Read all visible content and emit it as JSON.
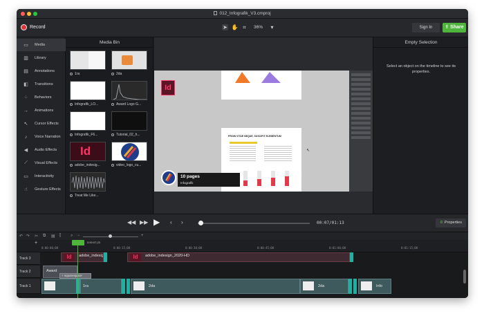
{
  "window": {
    "title": "012_Infografik_V3.cmproj",
    "traffic": [
      "#fe5f57",
      "#febc2e",
      "#28c840"
    ]
  },
  "toolbar": {
    "record_label": "Record",
    "zoom_label": "36%",
    "signin_label": "Sign In",
    "share_label": "Share"
  },
  "nav": {
    "items": [
      {
        "label": "Media",
        "icon": "film-icon"
      },
      {
        "label": "Library",
        "icon": "library-icon"
      },
      {
        "label": "Annotations",
        "icon": "annotation-icon"
      },
      {
        "label": "Transitions",
        "icon": "transition-icon"
      },
      {
        "label": "Behaviors",
        "icon": "behavior-icon"
      },
      {
        "label": "Animations",
        "icon": "arrow-icon"
      },
      {
        "label": "Cursor Effects",
        "icon": "cursor-icon"
      },
      {
        "label": "Voice Narration",
        "icon": "mic-icon"
      },
      {
        "label": "Audio Effects",
        "icon": "speaker-icon"
      },
      {
        "label": "Visual Effects",
        "icon": "visual-icon"
      },
      {
        "label": "Interactivity",
        "icon": "monitor-icon"
      },
      {
        "label": "Gesture Effects",
        "icon": "hand-icon"
      }
    ]
  },
  "media_bin": {
    "title": "Media Bin",
    "items": [
      {
        "label": "1ra"
      },
      {
        "label": "2da"
      },
      {
        "label": "Infografik_LO..."
      },
      {
        "label": "Award Logo G..."
      },
      {
        "label": "Infografik_F6..."
      },
      {
        "label": "Tutorial_02_h..."
      },
      {
        "label": "adobe_indesig..."
      },
      {
        "label": "video_logo_cu..."
      },
      {
        "label": "Treat Me Like..."
      }
    ]
  },
  "canvas": {
    "logo_text": "Id",
    "lower_third_title": "10 pages",
    "lower_third_sub": "Infografik",
    "page_heading": "PROIN VITAE NEQUE, SUSCIPIT ELEMENTUM"
  },
  "right_panel": {
    "title": "Empty Selection",
    "message": "Select an object on the timeline to see its properties."
  },
  "playback": {
    "timecode": "00:07/01:13",
    "properties_label": "Properties"
  },
  "timeline": {
    "playhead_time": "0:00:07;23",
    "ticks": [
      "0:00:00;00",
      "0:00:15;00",
      "0:00:30;00",
      "0:00:45;00",
      "0:01:00;00",
      "0:01:15;00"
    ],
    "tracks": [
      {
        "label": "Track 3"
      },
      {
        "label": "Track 2"
      },
      {
        "label": "Track 1"
      }
    ],
    "clips": {
      "t3_a": "adobe_indesign",
      "t3_b": "adobe_indesign_2020-HD",
      "t2_a": "Award",
      "t2_b": "+ squarespace",
      "t1_a": "1ra",
      "t1_b": "2da",
      "t1_c": "2da",
      "t1_d": "Info"
    }
  },
  "colors": {
    "accent": "#4fb53d",
    "record": "#e0323a",
    "indesign": "#ff3366"
  }
}
